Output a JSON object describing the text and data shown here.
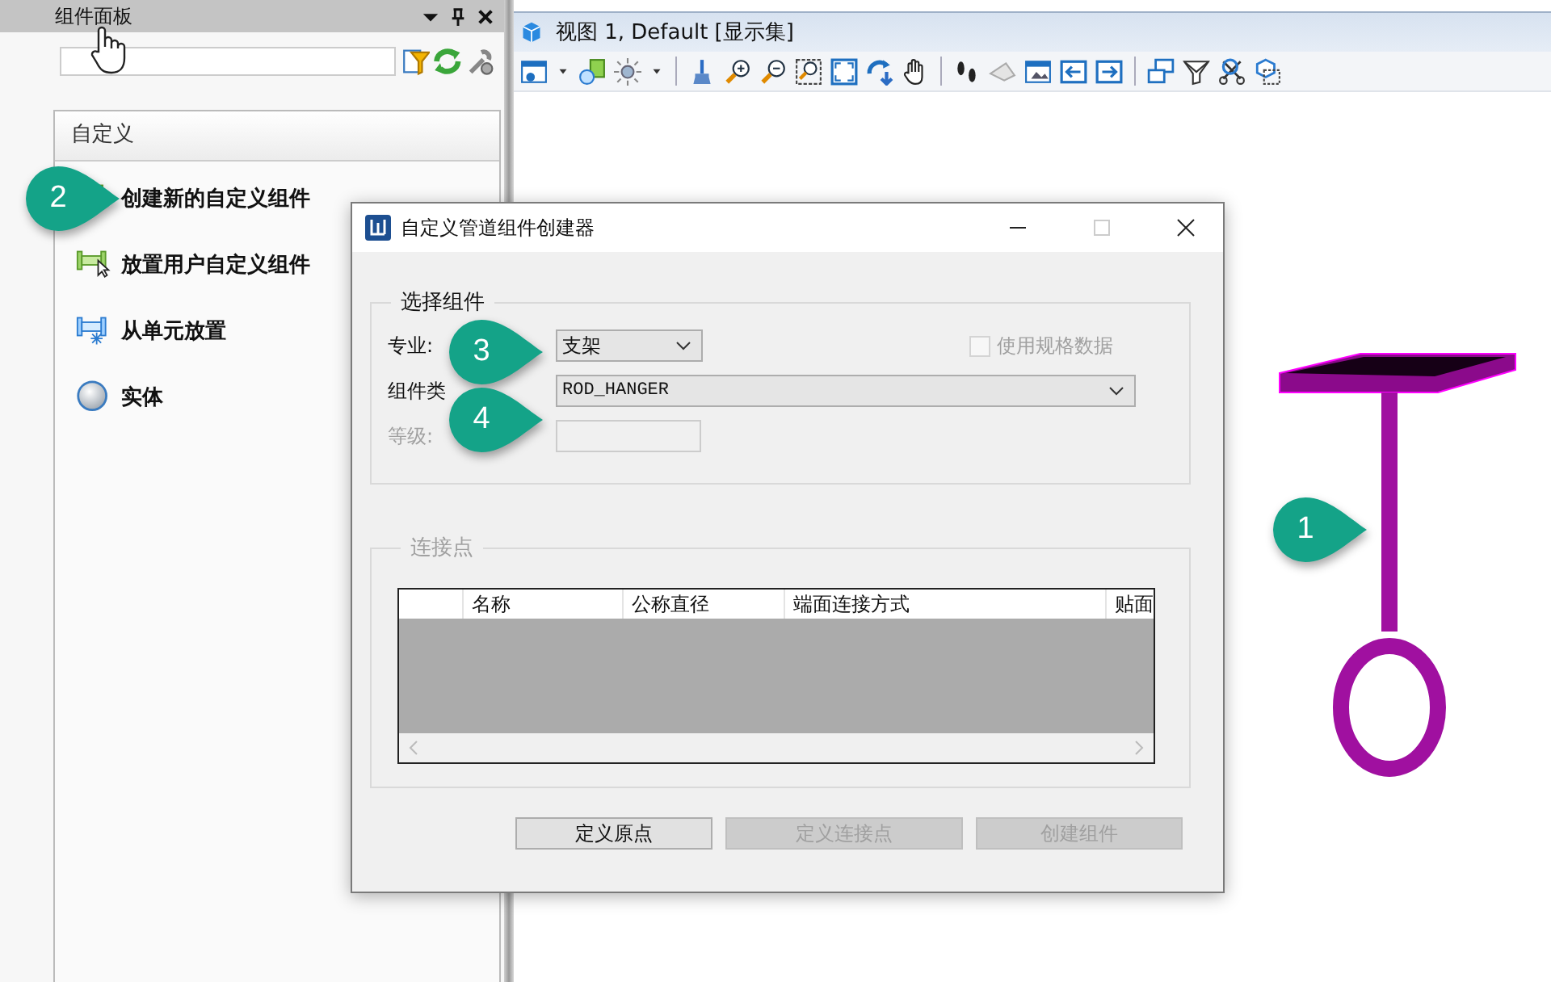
{
  "panel": {
    "title": "组件面板",
    "section": {
      "title": "自定义",
      "items": [
        {
          "label": "创建新的自定义组件",
          "kind": "create"
        },
        {
          "label": "放置用户自定义组件",
          "kind": "place"
        },
        {
          "label": "从单元放置",
          "kind": "cell"
        },
        {
          "label": "实体",
          "kind": "solid"
        }
      ]
    }
  },
  "view": {
    "title": "视图 1, Default [显示集]"
  },
  "dialog": {
    "title": "自定义管道组件创建器",
    "select_group": {
      "legend": "选择组件",
      "fields": [
        {
          "label": "专业:",
          "value": "支架",
          "kind": "combo",
          "disabled": false
        },
        {
          "label": "组件类",
          "value": "ROD_HANGER",
          "kind": "wide_combo",
          "disabled": false
        },
        {
          "label": "等级:",
          "kind": "text",
          "disabled": true
        }
      ],
      "use_spec": {
        "label": "使用规格数据",
        "checked": false,
        "disabled": true
      }
    },
    "connect_group": {
      "legend": "连接点",
      "disabled": true,
      "columns": [
        "名称",
        "公称直径",
        "端面连接方式",
        "贴面"
      ]
    },
    "buttons": [
      {
        "label": "定义原点",
        "disabled": false
      },
      {
        "label": "定义连接点",
        "disabled": true
      },
      {
        "label": "创建组件",
        "disabled": true
      }
    ]
  },
  "callouts": [
    {
      "number": "1"
    },
    {
      "number": "2"
    },
    {
      "number": "3"
    },
    {
      "number": "4"
    }
  ]
}
